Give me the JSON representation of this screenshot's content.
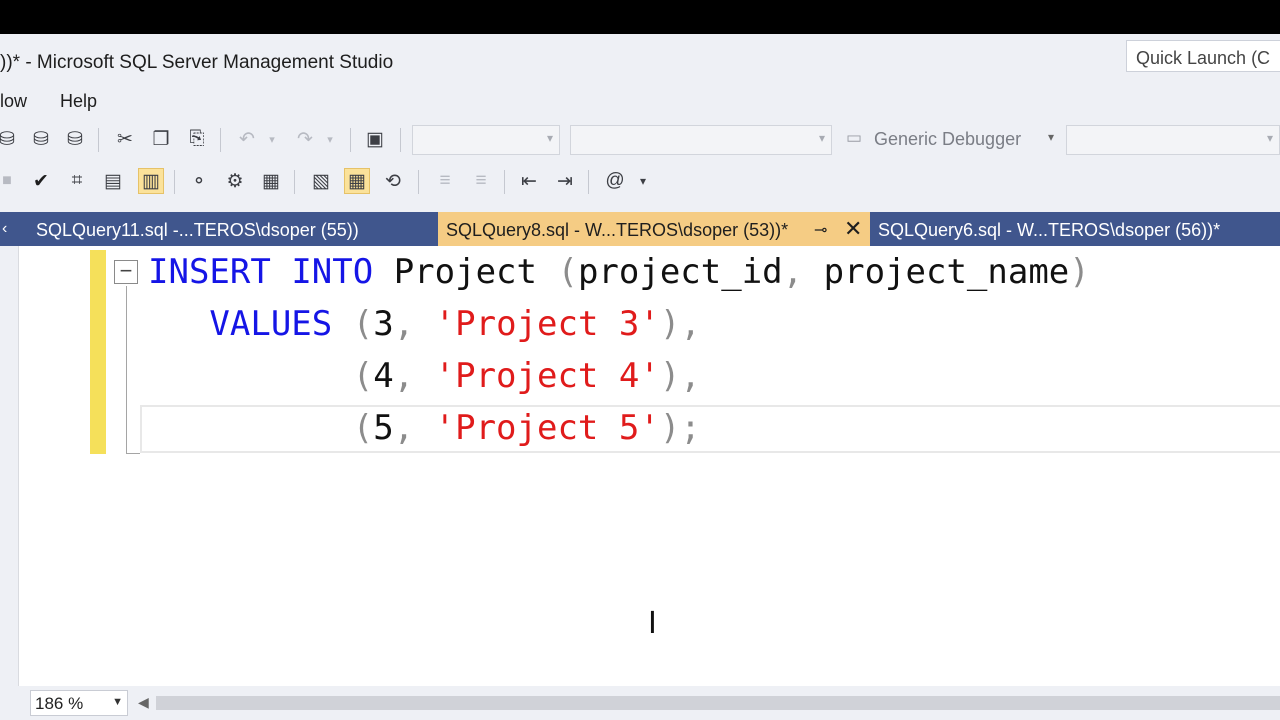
{
  "window": {
    "title": "))* - Microsoft SQL Server Management Studio",
    "quick_launch_placeholder": "Quick Launch (C"
  },
  "menu": [
    "low",
    "Help"
  ],
  "toolbar": {
    "debugger_label": "Generic Debugger"
  },
  "tabs": [
    {
      "label": "SQLQuery11.sql -...TEROS\\dsoper (55))",
      "active": false
    },
    {
      "label": "SQLQuery8.sql - W...TEROS\\dsoper (53))*",
      "active": true
    },
    {
      "label": "SQLQuery6.sql - W...TEROS\\dsoper (56))*",
      "active": false
    }
  ],
  "editor": {
    "line1": {
      "kw1": "INSERT",
      "kw2": "INTO",
      "table": "Project",
      "open": "(",
      "col1": "project_id",
      "comma": ",",
      "col2": "project_name",
      "close": ")"
    },
    "line2": {
      "kw": "VALUES",
      "open": "(",
      "num": "3",
      "comma": ",",
      "str": "'Project 3'",
      "close": "),",
      "trail": ""
    },
    "line3": {
      "open": "(",
      "num": "4",
      "comma": ",",
      "str": "'Project 4'",
      "close": "),"
    },
    "line4": {
      "open": "(",
      "num": "5",
      "comma": ",",
      "str": "'Project 5'",
      "close": ");"
    }
  },
  "status": {
    "zoom": "186 %"
  },
  "colors": {
    "tab_strip": "#40568d",
    "active_tab": "#f5cc84",
    "keyword": "#1515e6",
    "string": "#e01b1b",
    "change_bar": "#f5e05a"
  }
}
